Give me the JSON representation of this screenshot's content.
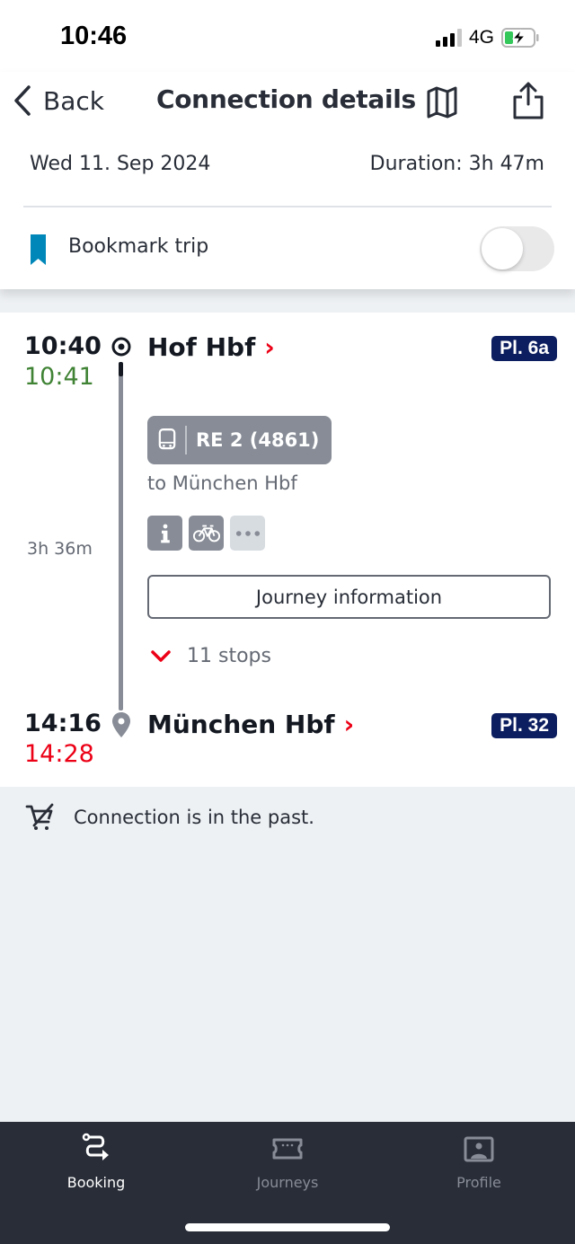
{
  "status_bar": {
    "time": "10:46",
    "network": "4G",
    "icons": [
      "signal-icon",
      "battery-charging-icon"
    ]
  },
  "header": {
    "back_label": "Back",
    "title": "Connection details",
    "map_icon": "map-icon",
    "share_icon": "share-icon",
    "date": "Wed 11. Sep 2024",
    "duration": "Duration: 3h 47m",
    "bookmark_label": "Bookmark trip",
    "bookmark_on": false
  },
  "colors": {
    "accent_red": "#ec0016",
    "ontime_green": "#408335",
    "platform_blue": "#0c1e5f",
    "bookmark_blue": "#0087b9",
    "tabbar_bg": "#282d37"
  },
  "connection": {
    "departure": {
      "scheduled": "10:40",
      "realtime": "10:41",
      "station": "Hof Hbf",
      "chevron": "›",
      "platform": "Pl. 6a"
    },
    "train": {
      "label": "RE 2 (4861)",
      "direction": "to München Hbf",
      "attributes": [
        "info-icon",
        "bicycle-icon",
        "more-icon"
      ],
      "segment_duration": "3h 36m",
      "journey_info_label": "Journey information",
      "stops_label": "11 stops"
    },
    "arrival": {
      "scheduled": "14:16",
      "realtime": "14:28",
      "station": "München Hbf",
      "chevron": "›",
      "platform": "Pl. 32"
    }
  },
  "notice": {
    "text": "Connection is in the past."
  },
  "tabbar": {
    "tabs": [
      {
        "label": "Booking",
        "icon": "route-icon",
        "active": true
      },
      {
        "label": "Journeys",
        "icon": "ticket-icon",
        "active": false
      },
      {
        "label": "Profile",
        "icon": "profile-icon",
        "active": false
      }
    ]
  }
}
